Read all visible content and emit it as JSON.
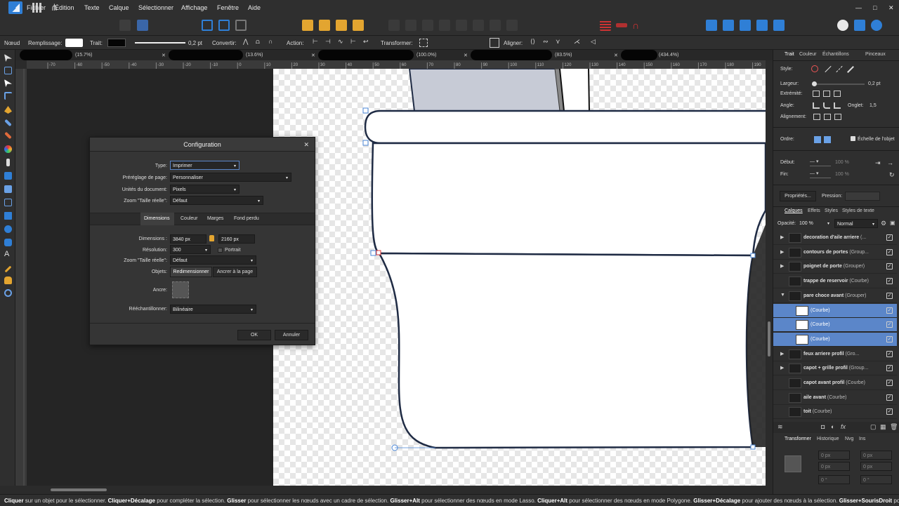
{
  "menu": [
    "Fichier",
    "Édition",
    "Texte",
    "Calque",
    "Sélectionner",
    "Affichage",
    "Fenêtre",
    "Aide"
  ],
  "window_controls": {
    "minimize": "—",
    "maximize": "□",
    "close": "✕"
  },
  "context_toolbar": {
    "mode": "Nœud",
    "fill_label": "Remplissage:",
    "stroke_label": "Trait:",
    "stroke_width": "0,2 pt",
    "convert_label": "Convertir:",
    "action_label": "Action:",
    "transform_label": "Transformer:",
    "align_label": "Aligner:"
  },
  "doc_tabs": [
    {
      "zoom": "(15.7%)"
    },
    {
      "zoom": "(13.6%)"
    },
    {
      "zoom": "(100.0%)"
    },
    {
      "zoom": "(83.5%)"
    },
    {
      "zoom": "(434.4%)"
    }
  ],
  "ruler_labels": [
    "-70",
    "-60",
    "-50",
    "-40",
    "-30",
    "-20",
    "-10",
    "0",
    "10",
    "20",
    "30",
    "40",
    "50",
    "60",
    "70",
    "80",
    "90",
    "100",
    "110",
    "120",
    "130",
    "140",
    "150",
    "160",
    "170",
    "180",
    "190"
  ],
  "right_panel": {
    "tabs": [
      "Trait",
      "Couleur",
      "Échantillons",
      "Pinceaux"
    ],
    "style_label": "Style:",
    "width_label": "Largeur:",
    "width_value": "0,2 pt",
    "cap_label": "Extrémité:",
    "angle_label": "Angle:",
    "miter_label": "Onglet:",
    "miter_value": "1,5",
    "align_label": "Alignement:",
    "order_label": "Ordre:",
    "scale_label": "Échelle de l'objet",
    "start_label": "Début:",
    "end_label": "Fin:",
    "pct1": "100 %",
    "pct2": "100 %",
    "props_button": "Propriétés...",
    "pressure_label": "Pression:"
  },
  "layers_panel": {
    "tabs": [
      "Calques",
      "Effets",
      "Styles",
      "Styles de texte"
    ],
    "opacity_label": "Opacité:",
    "opacity_value": "100 %",
    "blend_mode": "Normal",
    "layers": [
      {
        "name": "decoration d'aile arriere",
        "kind": "(...",
        "expand": "▶",
        "selected": false
      },
      {
        "name": "contours de portes",
        "kind": "(Group...",
        "expand": "▶",
        "selected": false
      },
      {
        "name": "poignet de porte",
        "kind": "(Grouper)",
        "expand": "▶",
        "selected": false
      },
      {
        "name": "trappe de reservoir",
        "kind": "(Courbe)",
        "expand": "",
        "selected": false
      },
      {
        "name": "pare choce avant",
        "kind": "(Grouper)",
        "expand": "▼",
        "selected": false
      },
      {
        "name": "",
        "kind": "(Courbe)",
        "expand": "",
        "selected": true
      },
      {
        "name": "",
        "kind": "(Courbe)",
        "expand": "",
        "selected": true
      },
      {
        "name": "",
        "kind": "(Courbe)",
        "expand": "",
        "selected": true
      },
      {
        "name": "feux arriere profil",
        "kind": "(Gro...",
        "expand": "▶",
        "selected": false
      },
      {
        "name": "capot + grille profil",
        "kind": "(Group...",
        "expand": "▶",
        "selected": false
      },
      {
        "name": "capot avant profil",
        "kind": "(Courbe)",
        "expand": "",
        "selected": false
      },
      {
        "name": "aile avant",
        "kind": "(Courbe)",
        "expand": "",
        "selected": false
      },
      {
        "name": "toit",
        "kind": "(Courbe)",
        "expand": "",
        "selected": false
      }
    ],
    "check": "✓"
  },
  "transform_panel": {
    "tabs": [
      "Transformer",
      "Historique",
      "Nvg",
      "Ins"
    ],
    "fields": [
      "0 px",
      "0 px",
      "0 px",
      "0 px",
      "0 °",
      "0 °"
    ]
  },
  "dialog": {
    "title": "Configuration",
    "close": "✕",
    "type_label": "Type:",
    "type_value": "Imprimer",
    "preset_label": "Préréglage de page:",
    "preset_value": "Personnaliser",
    "units_label": "Unités du document:",
    "units_value": "Pixels",
    "zoom_label": "Zoom \"Taille réelle\":",
    "zoom_value": "Défaut",
    "tabs": [
      "Dimensions",
      "Couleur",
      "Marges",
      "Fond perdu"
    ],
    "dims_label": "Dimensions :",
    "width": "3840 px",
    "height": "2160 px",
    "res_label": "Résolution:",
    "res_value": "300",
    "portrait_label": "Portrait",
    "zoom2_label": "Zoom \"Taille réelle\":",
    "zoom2_value": "Défaut",
    "objects_label": "Objets:",
    "resize_button": "Redimensionner",
    "anchor_button": "Ancrer à la page",
    "anchor_label": "Ancre:",
    "resample_label": "Rééchantillonner:",
    "resample_value": "Bilinéaire",
    "ok": "OK",
    "cancel": "Annuler"
  },
  "status": {
    "p1b": "Cliquer",
    "p1": " sur un objet pour le sélectionner. ",
    "p2b": "Cliquer+Décalage",
    "p2": " pour compléter la sélection. ",
    "p3b": "Glisser",
    "p3": " pour sélectionner les nœuds avec un cadre de sélection. ",
    "p4b": "Glisser+Alt",
    "p4": " pour sélectionner des nœuds en mode Lasso. ",
    "p5b": "Cliquer+Alt",
    "p5": " pour sélectionner des nœuds en mode Polygone. ",
    "p6b": "Glisser+Décalage",
    "p6": " pour ajouter des nœuds à la sélection. ",
    "p7b": "Glisser+SourisDroit",
    "p7": " pour a"
  },
  "colors": {
    "accent": "#5b86c9",
    "brand": "#2f7fd6",
    "stroke": "#1f2b44"
  }
}
